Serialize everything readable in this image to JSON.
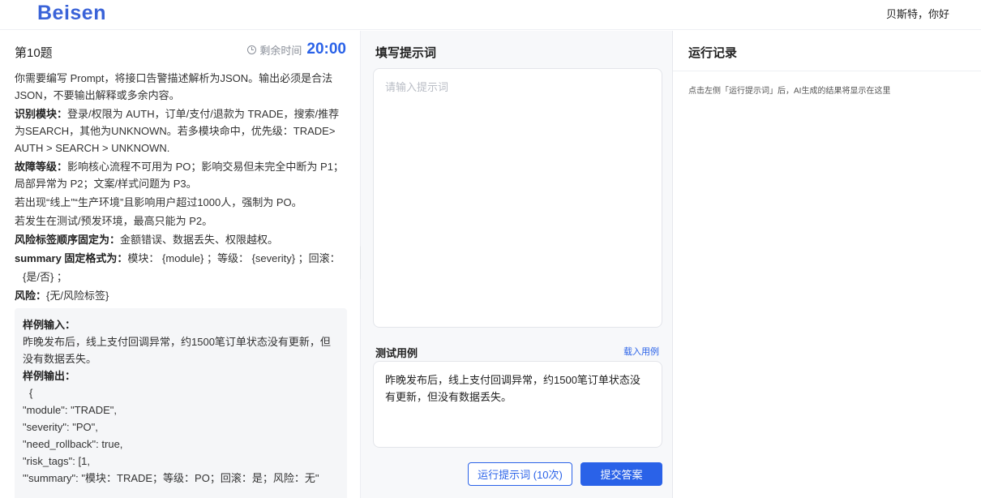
{
  "header": {
    "logo": "Beisen",
    "greeting": "贝斯特，你好"
  },
  "question": {
    "title": "第10题",
    "timer_label": "剩余时间",
    "timer_value": "20:00",
    "intro": "你需要编写 Prompt，将接口告警描述解析为JSON。输出必须是合法JSON，不要输出解释或多余内容。",
    "module_label": "识别模块：",
    "module_text": "登录/权限为 AUTH，订单/支付/退款为 TRADE，搜索/推荐为SEARCH，其他为UNKNOWN。若多模块命中，优先级：TRADE> AUTH > SEARCH > UNKNOWN.",
    "severity_label": "故障等级：",
    "severity_text": "影响核心流程不可用为 PO；影响交易但未完全中断为 P1；局部异常为 P2；文案/样式问题为 P3。",
    "rule1": "若出现“线上”“生产环境”且影响用户超过1000人，强制为 PO。",
    "rule2": "若发生在测试/预发环境，最高只能为 P2。",
    "risk_label": "风险标签顺序固定为：",
    "risk_text": "金额错误、数据丢失、权限越权。",
    "summary_label": "summary 固定格式为：",
    "summary_text": "模块： {module} ；等级： {severity} ；回滚：",
    "summary_text2": "{是/否} ；",
    "risk2_label": "风险：",
    "risk2_text": "{无/风险标签}"
  },
  "sample": {
    "input_label": "样例输入：",
    "input_text": "昨晚发布后，线上支付回调异常，约1500笔订单状态没有更新，但没有数据丢失。",
    "output_label": "样例输出：",
    "output_lines": [
      "{",
      "\"module\": \"TRADE\",",
      "\"severity\": \"PO\",",
      "\"need_rollback\": true,",
      "\"risk_tags\": [1,",
      "\"'summary\": \"模块：TRADE；等级：PO；回滚：是；风险：无\""
    ]
  },
  "editor": {
    "title": "填写提示词",
    "placeholder": "请输入提示词",
    "test_title": "测试用例",
    "load_link": "载入用例",
    "test_text": "昨晚发布后，线上支付回调异常，约1500笔订单状态没有更新，但没有数据丢失。",
    "run_button": "运行提示词 (10次)",
    "submit_button": "提交答案"
  },
  "record": {
    "title": "运行记录",
    "hint": "点击左侧「运行提示词」后，AI生成的结果将显示在这里"
  },
  "colors": {
    "accent": "#2a62e8",
    "logo": "#3a63d8"
  }
}
